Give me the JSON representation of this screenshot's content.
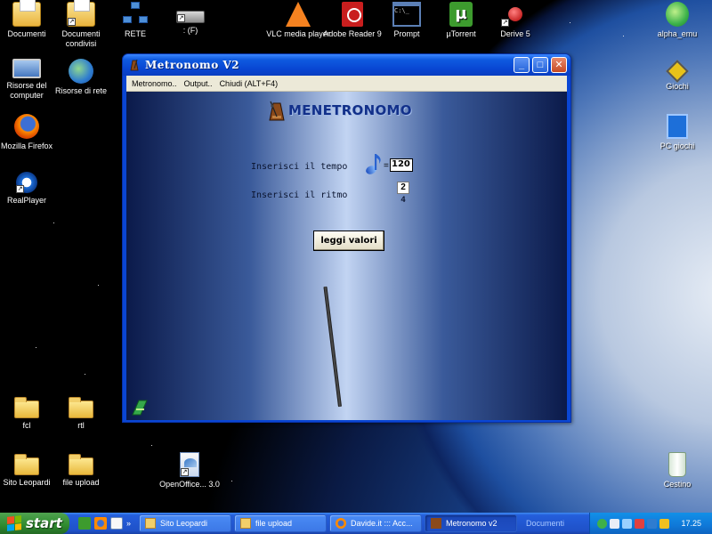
{
  "desktop": {
    "icons": [
      {
        "label": "Documenti"
      },
      {
        "label": "Documenti condivisi"
      },
      {
        "label": "RETE"
      },
      {
        "label": ": (F)"
      },
      {
        "label": "VLC media player"
      },
      {
        "label": "Adobe Reader 9"
      },
      {
        "label": "Prompt"
      },
      {
        "label": "µTorrent"
      },
      {
        "label": "Derive 5"
      },
      {
        "label": "alpha_emu"
      },
      {
        "label": "Risorse del computer"
      },
      {
        "label": "Risorse di rete"
      },
      {
        "label": "Giochi"
      },
      {
        "label": "Mozilla Firefox"
      },
      {
        "label": "PC giochi"
      },
      {
        "label": "RealPlayer"
      },
      {
        "label": "fcl"
      },
      {
        "label": "rtl"
      },
      {
        "label": "Sito Leopardi"
      },
      {
        "label": "file upload"
      },
      {
        "label": "OpenOffice... 3.0"
      },
      {
        "label": "Cestino"
      }
    ]
  },
  "window": {
    "title": "Metronomo  V2",
    "menu": [
      "Metronomo..",
      "Output..",
      "Chiudi (ALT+F4)"
    ],
    "header_text": "MENETRONOMO",
    "tempo_label": "Inserisci il tempo",
    "tempo_equals": "=",
    "tempo_value": "120",
    "ritmo_label": "Inserisci il ritmo",
    "ritmo_numerator": "2",
    "ritmo_denominator": "4",
    "button_label": "leggi valori"
  },
  "taskbar": {
    "start_label": "start",
    "tasks": [
      {
        "label": "Sito Leopardi"
      },
      {
        "label": "file upload"
      },
      {
        "label": "Davide.it ::: Acc..."
      },
      {
        "label": "Metronomo  v2"
      }
    ],
    "documents_label": "Documenti",
    "clock": "17.25"
  }
}
